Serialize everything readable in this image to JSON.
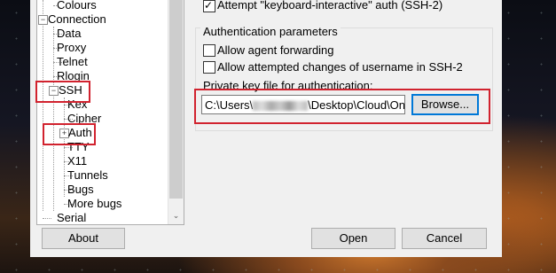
{
  "tree": {
    "items": [
      "Colours",
      "Connection",
      "Data",
      "Proxy",
      "Telnet",
      "Rlogin",
      "SSH",
      "Kex",
      "Cipher",
      "Auth",
      "TTY",
      "X11",
      "Tunnels",
      "Bugs",
      "More bugs",
      "Serial"
    ],
    "expander_collapsed": "+",
    "expander_expanded": "−",
    "scroll_down": "⌄"
  },
  "auth": {
    "keyboard_interactive": "Attempt \"keyboard-interactive\" auth (SSH-2)",
    "group_title": "Authentication parameters",
    "agent_forwarding": "Allow agent forwarding",
    "username_changes": "Allow attempted changes of username in SSH-2",
    "private_key_label": "Private key file for authentication:",
    "path_prefix": "C:\\Users\\",
    "path_suffix": "\\Desktop\\Cloud\\OneDriv",
    "browse": "Browse..."
  },
  "buttons": {
    "about": "About",
    "open": "Open",
    "cancel": "Cancel"
  },
  "colors": {
    "highlight": "#d1222e",
    "focus": "#0078d7"
  }
}
